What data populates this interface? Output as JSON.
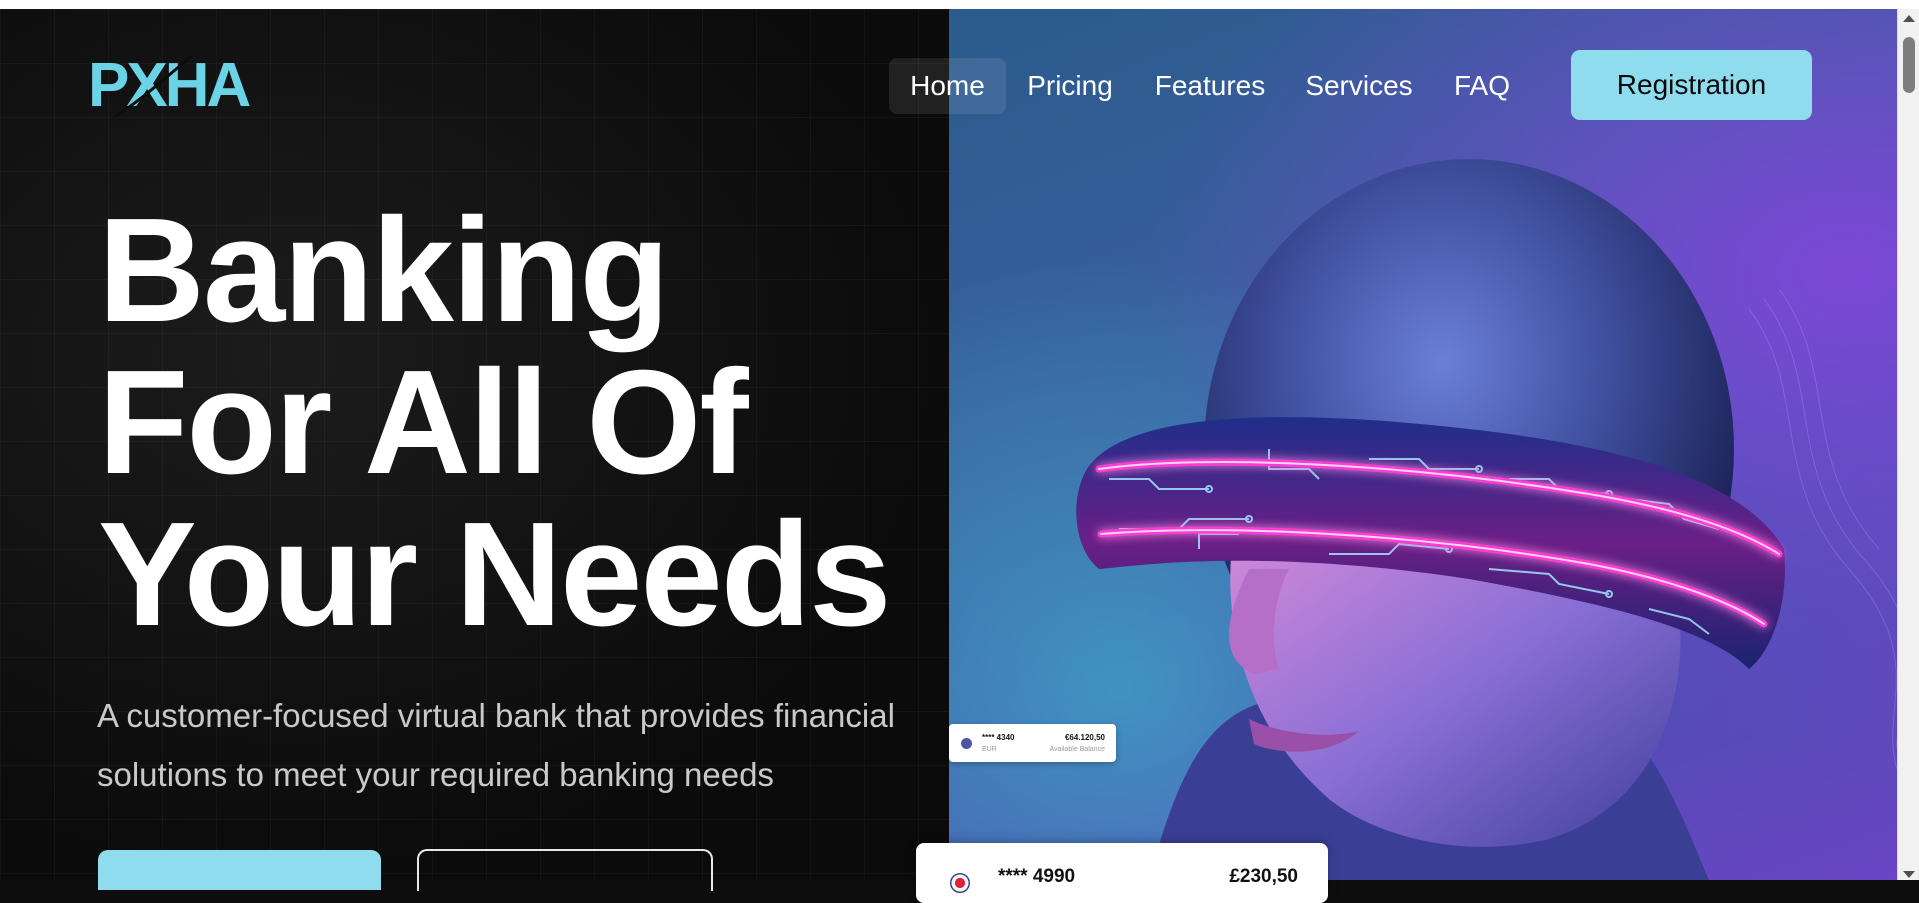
{
  "brand": {
    "logo_text": "PXHA",
    "color": "#6ad3e6"
  },
  "nav": {
    "items": [
      {
        "label": "Home",
        "active": true
      },
      {
        "label": "Pricing"
      },
      {
        "label": "Features"
      },
      {
        "label": "Services"
      },
      {
        "label": "FAQ"
      }
    ],
    "register_label": "Registration"
  },
  "hero": {
    "headline_lines": [
      "Banking",
      "For All Of",
      "Your Needs"
    ],
    "subtext": "A customer-focused virtual bank that provides financial solutions to meet your required banking needs"
  },
  "cards": {
    "small": {
      "number": "**** 4340",
      "currency": "EUR",
      "balance": "€64.120,50",
      "balance_label": "Available Balance"
    },
    "large": {
      "number": "**** 4990",
      "balance": "£230,50"
    }
  },
  "colors": {
    "accent": "#8fdcef",
    "background": "#0c0c0c",
    "glow": "#ff3ad6",
    "circuit": "#9fe6ff"
  },
  "icons": {
    "scroll_up": "chevron-up-icon",
    "scroll_down": "chevron-down-icon",
    "flag": "gb-flag-icon"
  }
}
